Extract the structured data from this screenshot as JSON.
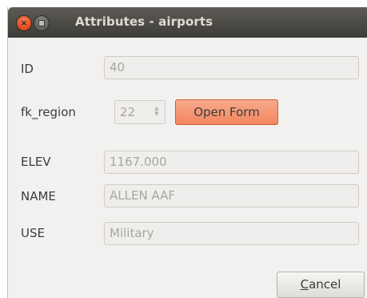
{
  "window": {
    "title": "Attributes - airports",
    "close_glyph": "×"
  },
  "fields": {
    "id": {
      "label": "ID",
      "value": "40"
    },
    "fk_region": {
      "label": "fk_region",
      "value": "22"
    },
    "elev": {
      "label": "ELEV",
      "value": "1167.000"
    },
    "name": {
      "label": "NAME",
      "value": "ALLEN AAF"
    },
    "use": {
      "label": "USE",
      "value": "Military"
    }
  },
  "buttons": {
    "open_form": "Open Form",
    "cancel_mnemonic": "C",
    "cancel_rest": "ancel"
  },
  "icons": {
    "spin_up": "▲",
    "spin_down": "▼"
  },
  "colors": {
    "accent": "#f2865f",
    "close_button": "#e0491c"
  }
}
